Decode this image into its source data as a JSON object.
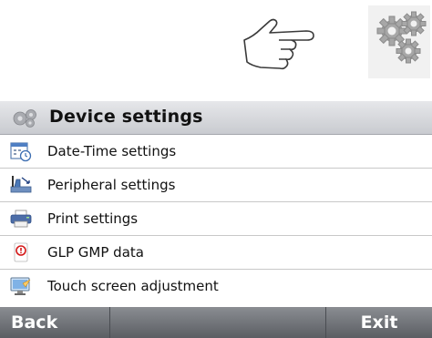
{
  "header": {
    "title": "Device settings",
    "icon": "gears-icon"
  },
  "menu": [
    {
      "label": "Date-Time settings",
      "icon": "calendar-clock-icon"
    },
    {
      "label": "Peripheral settings",
      "icon": "peripheral-icon"
    },
    {
      "label": "Print settings",
      "icon": "printer-icon"
    },
    {
      "label": "GLP GMP data",
      "icon": "glp-icon"
    },
    {
      "label": "Touch screen adjustment",
      "icon": "touch-screen-icon"
    }
  ],
  "footer": {
    "back_label": "Back",
    "exit_label": "Exit"
  }
}
